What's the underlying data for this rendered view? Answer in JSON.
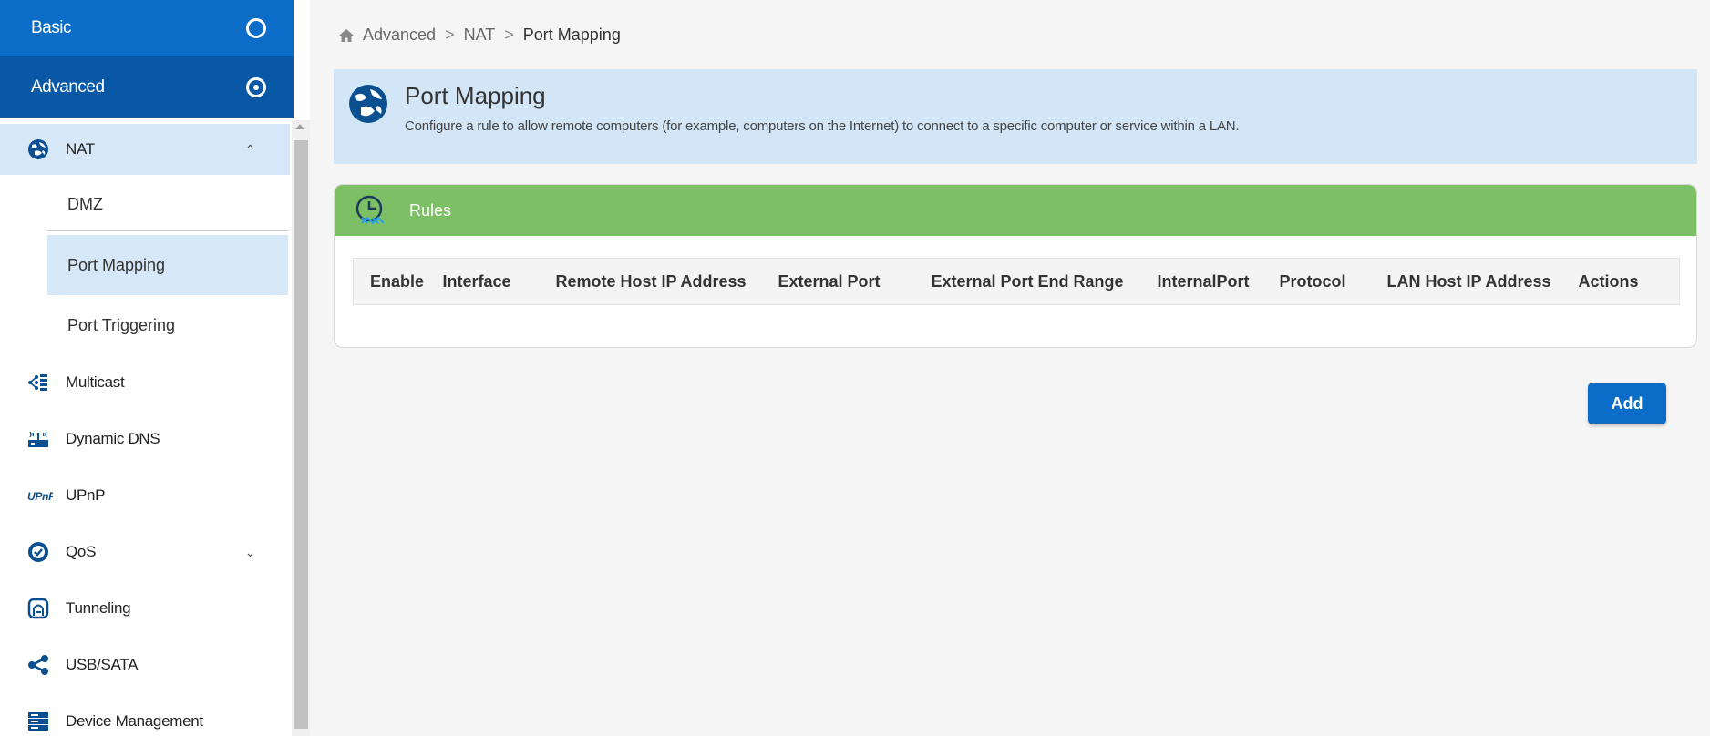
{
  "sidebar": {
    "basic_label": "Basic",
    "advanced_label": "Advanced",
    "nat_label": "NAT",
    "sub_items": [
      "DMZ",
      "Port Mapping",
      "Port Triggering"
    ],
    "items": [
      {
        "label": "Multicast",
        "icon": "multicast-icon"
      },
      {
        "label": "Dynamic DNS",
        "icon": "dynamic-dns-icon"
      },
      {
        "label": "UPnP",
        "icon": "upnp-icon"
      },
      {
        "label": "QoS",
        "icon": "qos-icon"
      },
      {
        "label": "Tunneling",
        "icon": "tunneling-icon"
      },
      {
        "label": "USB/SATA",
        "icon": "share-icon"
      },
      {
        "label": "Device Management",
        "icon": "server-icon"
      }
    ]
  },
  "breadcrumb": {
    "items": [
      "Advanced",
      "NAT",
      "Port Mapping"
    ],
    "separator": ">"
  },
  "banner": {
    "title": "Port Mapping",
    "description": "Configure a rule to allow remote computers (for example, computers on the Internet) to connect to a specific computer or service within a LAN."
  },
  "rules": {
    "title": "Rules",
    "columns": [
      "Enable",
      "Interface",
      "Remote Host IP Address",
      "External Port",
      "External Port End Range",
      "InternalPort",
      "Protocol",
      "LAN Host IP Address",
      "Actions"
    ],
    "rows": []
  },
  "actions": {
    "add_label": "Add"
  },
  "colors": {
    "primary": "#0b6dc7",
    "primary_dark": "#0858a5",
    "selected_bg": "#d6e7f7",
    "banner_bg": "#d2e6f7",
    "panel_header": "#7dbf65"
  }
}
